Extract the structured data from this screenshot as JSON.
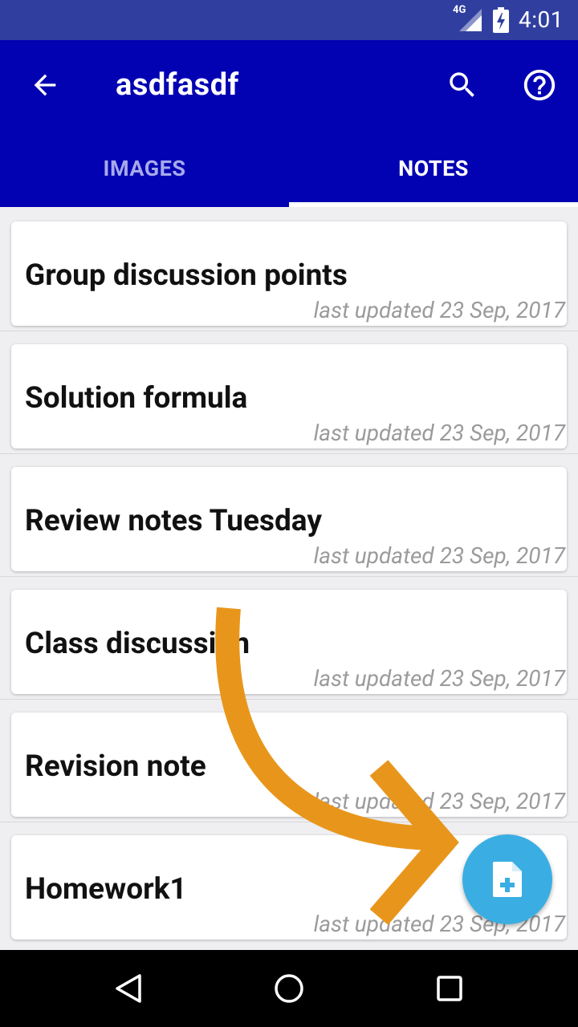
{
  "status_bar": {
    "network": "4G",
    "time": "4:01"
  },
  "toolbar": {
    "title": "asdfasdf",
    "back_icon": "arrow-back-icon",
    "search_icon": "search-icon",
    "help_icon": "help-icon"
  },
  "tabs": [
    {
      "label": "IMAGES",
      "active": false
    },
    {
      "label": "NOTES",
      "active": true
    }
  ],
  "notes": [
    {
      "title": "Group discussion points",
      "updated": "last updated 23 Sep, 2017"
    },
    {
      "title": "Solution formula",
      "updated": "last updated 23 Sep, 2017"
    },
    {
      "title": "Review notes Tuesday",
      "updated": "last updated 23 Sep, 2017"
    },
    {
      "title": "Class discussion",
      "updated": "last updated 23 Sep, 2017"
    },
    {
      "title": "Revision note",
      "updated": "last updated 23 Sep, 2017"
    },
    {
      "title": "Homework1",
      "updated": "last updated 23 Sep, 2017"
    }
  ],
  "fab": {
    "icon": "add-note-icon"
  },
  "colors": {
    "app_bar": "#0202b3",
    "status_bar": "#303f9f",
    "fab": "#3aaee3",
    "arrow": "#e8961b"
  },
  "nav": {
    "back_icon": "nav-back-icon",
    "home_icon": "nav-home-icon",
    "recents_icon": "nav-recents-icon"
  }
}
